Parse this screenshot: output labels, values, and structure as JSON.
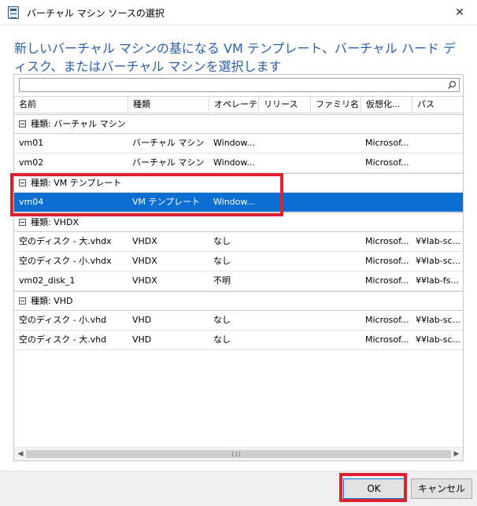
{
  "window": {
    "title": "バーチャル マシン ソースの選択",
    "close_glyph": "✕"
  },
  "heading": "新しいバーチャル マシンの基になる VM テンプレート、バーチャル ハード ディスク、またはバーチャル マシンを選択します",
  "search": {
    "value": "",
    "placeholder": ""
  },
  "columns": [
    "名前",
    "種類",
    "オペレーテ...",
    "リリース",
    "ファミリ名",
    "仮想化...",
    "パス"
  ],
  "groups": [
    {
      "label": "種類:  バーチャル マシン",
      "rows": [
        {
          "name": "vm01",
          "type": "バーチャル マシン",
          "os": "Window...",
          "release": "",
          "family": "",
          "virt": "Microsof...",
          "path": ""
        },
        {
          "name": "vm02",
          "type": "バーチャル マシン",
          "os": "Window...",
          "release": "",
          "family": "",
          "virt": "Microsof...",
          "path": ""
        }
      ]
    },
    {
      "label": "種類:  VM テンプレート",
      "rows": [
        {
          "name": "vm04",
          "type": "VM テンプレート",
          "os": "Window...",
          "release": "",
          "family": "",
          "virt": "",
          "path": "",
          "selected": true
        }
      ]
    },
    {
      "label": "種類:  VHDX",
      "rows": [
        {
          "name": "空のディスク - 大.vhdx",
          "type": "VHDX",
          "os": "なし",
          "release": "",
          "family": "",
          "virt": "Microsof...",
          "path": "¥¥lab-sc..."
        },
        {
          "name": "空のディスク - 小.vhdx",
          "type": "VHDX",
          "os": "なし",
          "release": "",
          "family": "",
          "virt": "Microsof...",
          "path": "¥¥lab-sc..."
        },
        {
          "name": "vm02_disk_1",
          "type": "VHDX",
          "os": "不明",
          "release": "",
          "family": "",
          "virt": "Microsof...",
          "path": "¥¥lab-fs..."
        }
      ]
    },
    {
      "label": "種類:  VHD",
      "rows": [
        {
          "name": "空のディスク - 小.vhd",
          "type": "VHD",
          "os": "なし",
          "release": "",
          "family": "",
          "virt": "Microsof...",
          "path": "¥¥lab-sc..."
        },
        {
          "name": "空のディスク - 大.vhd",
          "type": "VHD",
          "os": "なし",
          "release": "",
          "family": "",
          "virt": "Microsof...",
          "path": "¥¥lab-sc..."
        }
      ]
    }
  ],
  "scrollbar": {
    "left_glyph": "◀",
    "right_glyph": "▶"
  },
  "buttons": {
    "ok": "OK",
    "cancel": "キャンセル"
  },
  "colors": {
    "heading": "#2d5faa",
    "selection": "#0a6fd0",
    "highlight_box": "#e02030"
  },
  "icons": {
    "app": "window-icon",
    "search": "search-icon",
    "close": "close-icon"
  }
}
